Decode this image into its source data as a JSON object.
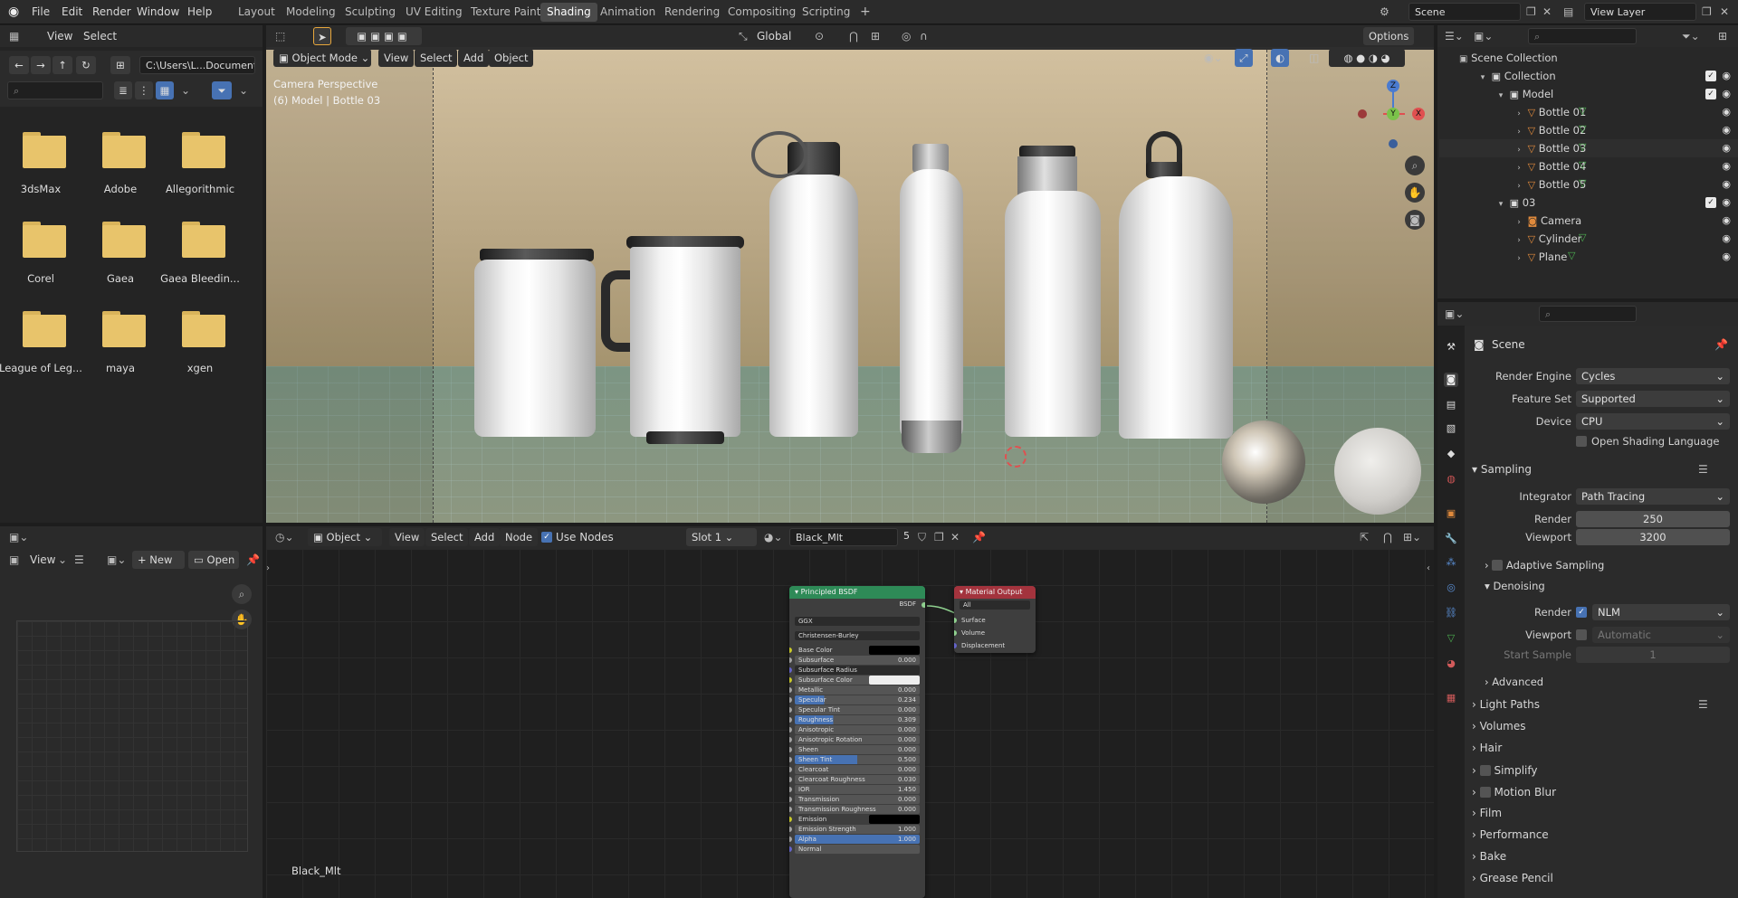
{
  "topbar": {
    "menus": [
      "File",
      "Edit",
      "Render",
      "Window",
      "Help"
    ],
    "workspaces": [
      {
        "label": "Layout",
        "active": false
      },
      {
        "label": "Modeling",
        "active": false
      },
      {
        "label": "Sculpting",
        "active": false
      },
      {
        "label": "UV Editing",
        "active": false
      },
      {
        "label": "Texture Paint",
        "active": false
      },
      {
        "label": "Shading",
        "active": true
      },
      {
        "label": "Animation",
        "active": false
      },
      {
        "label": "Rendering",
        "active": false
      },
      {
        "label": "Compositing",
        "active": false
      },
      {
        "label": "Scripting",
        "active": false
      }
    ],
    "add_tab": "+",
    "scene": "Scene",
    "view_layer": "View Layer"
  },
  "filebrowser": {
    "menu": [
      "View",
      "Select"
    ],
    "path": "C:\\Users\\L...Documents\\",
    "folders": [
      "3dsMax",
      "Adobe",
      "Allegorithmic",
      "Corel",
      "Gaea",
      "Gaea Bleedin...",
      "League of Leg...",
      "maya",
      "xgen"
    ]
  },
  "viewport": {
    "mode": "Object Mode",
    "menus": [
      "View",
      "Select",
      "Add",
      "Object"
    ],
    "orientation": "Global",
    "options": "Options",
    "overlay_line1": "Camera Perspective",
    "overlay_line2": "(6) Model | Bottle 03",
    "axes": {
      "z": "Z",
      "y": "Y",
      "x": "X"
    }
  },
  "image_editor": {
    "view": "View",
    "new": "New",
    "open": "Open"
  },
  "node_editor": {
    "object": "Object",
    "menus": [
      "View",
      "Select",
      "Add",
      "Node"
    ],
    "use_nodes": "Use Nodes",
    "slot": "Slot 1",
    "material": "Black_Mlt",
    "users": "5",
    "material_label": "Black_Mlt",
    "bsdf": {
      "title": "Principled BSDF",
      "output": "BSDF",
      "distribution": "GGX",
      "subsurface_method": "Christensen-Burley",
      "rows": [
        {
          "label": "Base Color",
          "value": ""
        },
        {
          "label": "Subsurface",
          "value": "0.000"
        },
        {
          "label": "Subsurface Radius",
          "value": ""
        },
        {
          "label": "Subsurface Color",
          "value": ""
        },
        {
          "label": "Metallic",
          "value": "0.000"
        },
        {
          "label": "Specular",
          "value": "0.234"
        },
        {
          "label": "Specular Tint",
          "value": "0.000"
        },
        {
          "label": "Roughness",
          "value": "0.309"
        },
        {
          "label": "Anisotropic",
          "value": "0.000"
        },
        {
          "label": "Anisotropic Rotation",
          "value": "0.000"
        },
        {
          "label": "Sheen",
          "value": "0.000"
        },
        {
          "label": "Sheen Tint",
          "value": "0.500"
        },
        {
          "label": "Clearcoat",
          "value": "0.000"
        },
        {
          "label": "Clearcoat Roughness",
          "value": "0.030"
        },
        {
          "label": "IOR",
          "value": "1.450"
        },
        {
          "label": "Transmission",
          "value": "0.000"
        },
        {
          "label": "Transmission Roughness",
          "value": "0.000"
        },
        {
          "label": "Emission",
          "value": ""
        },
        {
          "label": "Emission Strength",
          "value": "1.000"
        },
        {
          "label": "Alpha",
          "value": "1.000"
        },
        {
          "label": "Normal",
          "value": ""
        }
      ]
    },
    "output": {
      "title": "Material Output",
      "target": "All",
      "sockets": [
        "Surface",
        "Volume",
        "Displacement"
      ]
    }
  },
  "outliner": {
    "root": "Scene Collection",
    "rows": [
      {
        "label": "Collection",
        "indent": 1,
        "type": "collection",
        "check": true
      },
      {
        "label": "Model",
        "indent": 2,
        "type": "collection",
        "check": true
      },
      {
        "label": "Bottle 01",
        "indent": 3,
        "type": "mesh",
        "check": false
      },
      {
        "label": "Bottle 02",
        "indent": 3,
        "type": "mesh",
        "check": false
      },
      {
        "label": "Bottle 03",
        "indent": 3,
        "type": "mesh",
        "check": false
      },
      {
        "label": "Bottle 04",
        "indent": 3,
        "type": "mesh",
        "check": false
      },
      {
        "label": "Bottle 05",
        "indent": 3,
        "type": "mesh",
        "check": false
      },
      {
        "label": "03",
        "indent": 2,
        "type": "collection",
        "check": true
      },
      {
        "label": "Camera",
        "indent": 3,
        "type": "camera",
        "check": false
      },
      {
        "label": "Cylinder",
        "indent": 3,
        "type": "mesh",
        "check": false
      },
      {
        "label": "Plane",
        "indent": 3,
        "type": "mesh",
        "check": false
      }
    ]
  },
  "properties": {
    "scene": "Scene",
    "render_engine": {
      "label": "Render Engine",
      "value": "Cycles"
    },
    "feature_set": {
      "label": "Feature Set",
      "value": "Supported"
    },
    "device": {
      "label": "Device",
      "value": "CPU"
    },
    "osl": "Open Shading Language",
    "sampling": "Sampling",
    "integrator": {
      "label": "Integrator",
      "value": "Path Tracing"
    },
    "render": {
      "label": "Render",
      "value": "250"
    },
    "viewport": {
      "label": "Viewport",
      "value": "3200"
    },
    "adaptive": "Adaptive Sampling",
    "denoising": "Denoising",
    "dn_render": {
      "label": "Render",
      "value": "NLM"
    },
    "dn_viewport": {
      "label": "Viewport",
      "value": "Automatic"
    },
    "start_sample": {
      "label": "Start Sample",
      "value": "1"
    },
    "advanced": "Advanced",
    "sections": [
      "Light Paths",
      "Volumes",
      "Hair",
      "Simplify",
      "Motion Blur",
      "Film",
      "Performance",
      "Bake",
      "Grease Pencil"
    ]
  }
}
